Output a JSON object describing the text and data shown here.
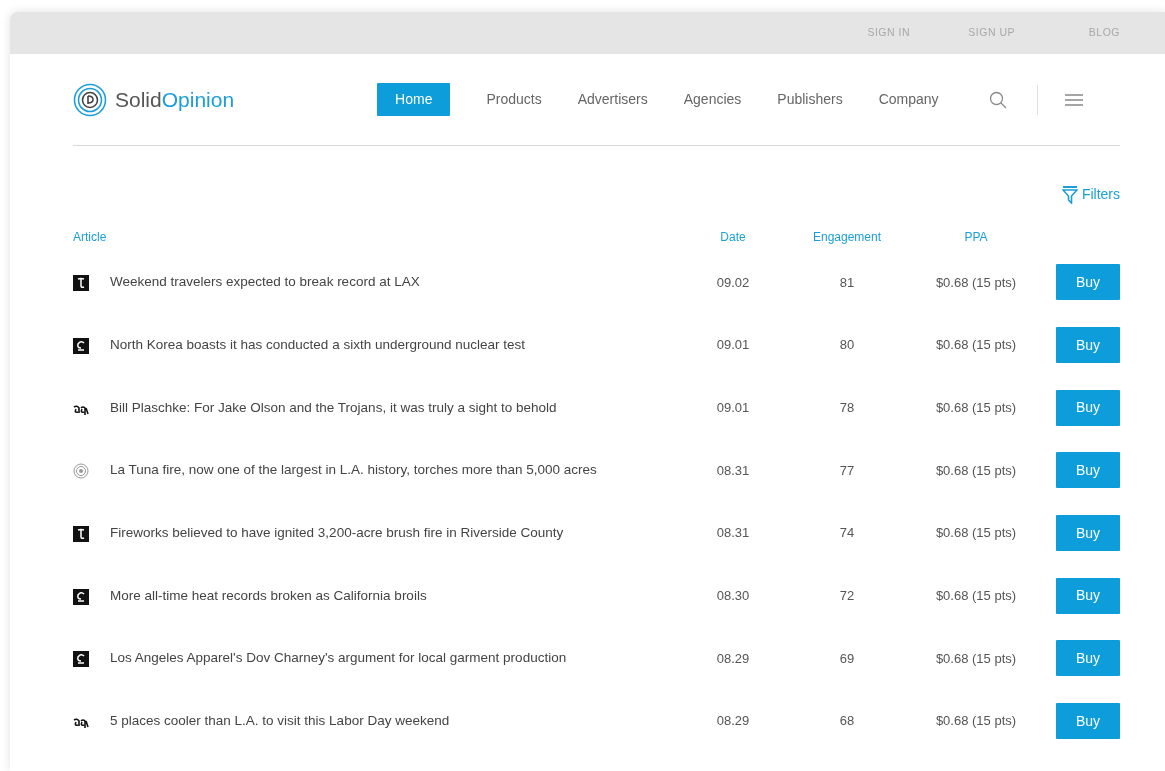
{
  "top_links": [
    "SIGN IN",
    "SIGN UP",
    "BLOG"
  ],
  "logo": {
    "first": "Solid",
    "second": "Opinion"
  },
  "nav": [
    {
      "label": "Home",
      "selected": true
    },
    {
      "label": "Products",
      "selected": false
    },
    {
      "label": "Advertisers",
      "selected": false
    },
    {
      "label": "Agencies",
      "selected": false
    },
    {
      "label": "Publishers",
      "selected": false
    },
    {
      "label": "Company",
      "selected": false
    }
  ],
  "filters": "Filters",
  "columns": [
    "Article",
    "Date",
    "Engagement",
    "PPA"
  ],
  "rows": [
    {
      "kind": "square-a",
      "title": "Weekend travelers expected to break record at LAX",
      "date": "09.02",
      "engagement": "81",
      "ppa": "$0.68 (15 pts)",
      "action": "Buy"
    },
    {
      "kind": "square-b",
      "title": "North Korea boasts it has conducted a sixth underground nuclear test",
      "date": "09.01",
      "engagement": "80",
      "ppa": "$0.68 (15 pts)",
      "action": "Buy"
    },
    {
      "kind": "script",
      "title": "Bill Plaschke: For Jake Olson and the Trojans, it was truly a sight to behold",
      "date": "09.01",
      "engagement": "78",
      "ppa": "$0.68 (15 pts)",
      "action": "Buy"
    },
    {
      "kind": "rings",
      "title": "La Tuna fire, now one of the largest in L.A. history, torches more than 5,000 acres",
      "date": "08.31",
      "engagement": "77",
      "ppa": "$0.68 (15 pts)",
      "action": "Buy"
    },
    {
      "kind": "square-a",
      "title": "Fireworks believed to have ignited 3,200-acre brush fire in Riverside County",
      "date": "08.31",
      "engagement": "74",
      "ppa": "$0.68 (15 pts)",
      "action": "Buy"
    },
    {
      "kind": "square-b",
      "title": "More all-time heat records broken as California broils",
      "date": "08.30",
      "engagement": "72",
      "ppa": "$0.68 (15 pts)",
      "action": "Buy"
    },
    {
      "kind": "square-b",
      "title": "Los Angeles Apparel's Dov Charney's argument for local garment production",
      "date": "08.29",
      "engagement": "69",
      "ppa": "$0.68 (15 pts)",
      "action": "Buy"
    },
    {
      "kind": "script",
      "title": "5 places cooler than L.A. to visit this Labor Day weekend",
      "date": "08.29",
      "engagement": "68",
      "ppa": "$0.68 (15 pts)",
      "action": "Buy"
    }
  ]
}
